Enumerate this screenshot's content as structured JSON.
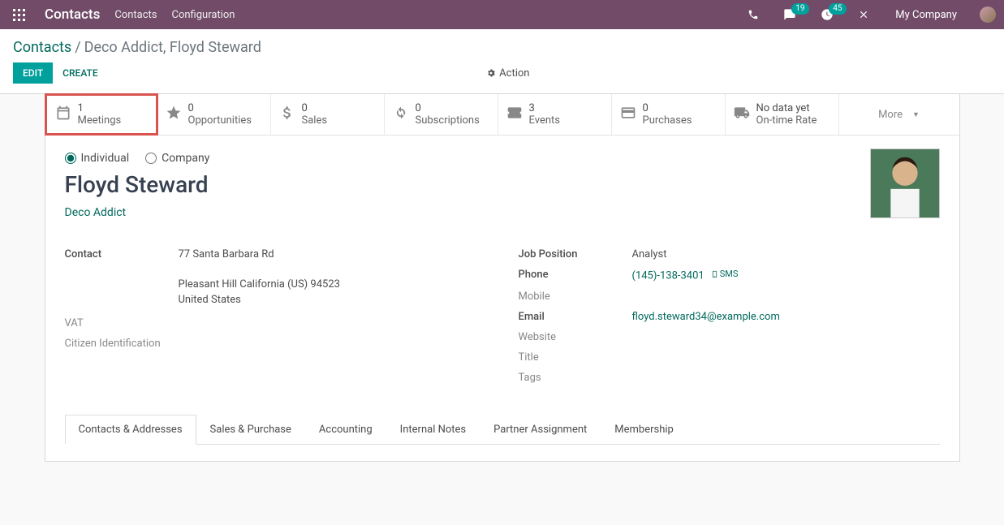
{
  "nav": {
    "brand": "Contacts",
    "menu": [
      "Contacts",
      "Configuration"
    ],
    "chat_badge": "19",
    "clock_badge": "45",
    "company": "My Company"
  },
  "breadcrumb": {
    "root": "Contacts",
    "current": "Deco Addict, Floyd Steward"
  },
  "buttons": {
    "edit": "EDIT",
    "create": "CREATE",
    "action": "Action"
  },
  "stats": {
    "meetings": {
      "count": "1",
      "label": "Meetings"
    },
    "opps": {
      "count": "0",
      "label": "Opportunities"
    },
    "sales": {
      "count": "0",
      "label": "Sales"
    },
    "subs": {
      "count": "0",
      "label": "Subscriptions"
    },
    "events": {
      "count": "3",
      "label": "Events"
    },
    "purchases": {
      "count": "0",
      "label": "Purchases"
    },
    "ontime": {
      "count": "No data yet",
      "label": "On-time Rate"
    },
    "more": "More"
  },
  "type": {
    "individual": "Individual",
    "company": "Company"
  },
  "name": "Floyd Steward",
  "company_link": "Deco Addict",
  "left": {
    "contact_label": "Contact",
    "street": "77 Santa Barbara Rd",
    "city_line": "Pleasant Hill  California (US)  94523",
    "country": "United States",
    "vat_label": "VAT",
    "cid_label": "Citizen Identification"
  },
  "right": {
    "job_label": "Job Position",
    "job": "Analyst",
    "phone_label": "Phone",
    "phone": "(145)-138-3401",
    "sms": "SMS",
    "mobile_label": "Mobile",
    "email_label": "Email",
    "email": "floyd.steward34@example.com",
    "website_label": "Website",
    "title_label": "Title",
    "tags_label": "Tags"
  },
  "tabs": [
    "Contacts & Addresses",
    "Sales & Purchase",
    "Accounting",
    "Internal Notes",
    "Partner Assignment",
    "Membership"
  ]
}
